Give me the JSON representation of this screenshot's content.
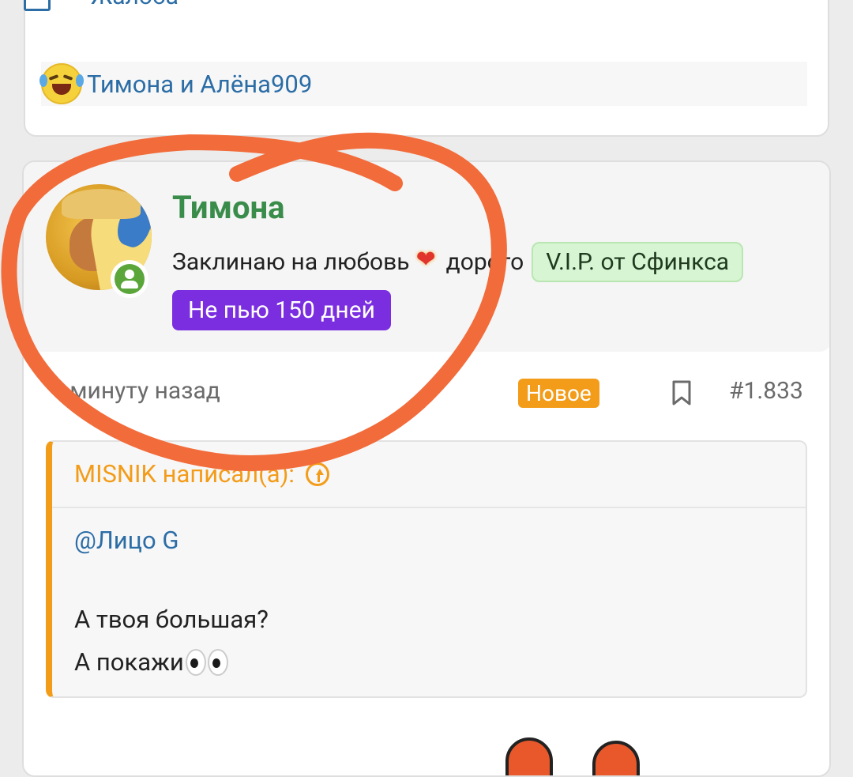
{
  "previous_post": {
    "report_label": "Жалоба",
    "reactions_text": "Тимона и Алёна909"
  },
  "post": {
    "username": "Тимона",
    "user_title_before": "Заклинаю на любовь",
    "user_title_after": "дорого",
    "vip_badge": "V.I.P. от Сфинкса",
    "sober_badge": "Не пью 150 дней",
    "time_ago": "1 минуту назад",
    "new_badge": "Новое",
    "post_number": "#1.833",
    "quote": {
      "author_line": "MISNIK написал(а):",
      "mention": "@Лицо G",
      "line1": "А твоя большая?",
      "line2": "А покажи"
    }
  },
  "colors": {
    "username": "#3a8c4a",
    "link": "#2c6da6",
    "accent_orange": "#f39c1a",
    "vip_bg": "#d7f5d2",
    "sober_bg": "#7a2ee0",
    "annotation": "#f26b3a"
  }
}
